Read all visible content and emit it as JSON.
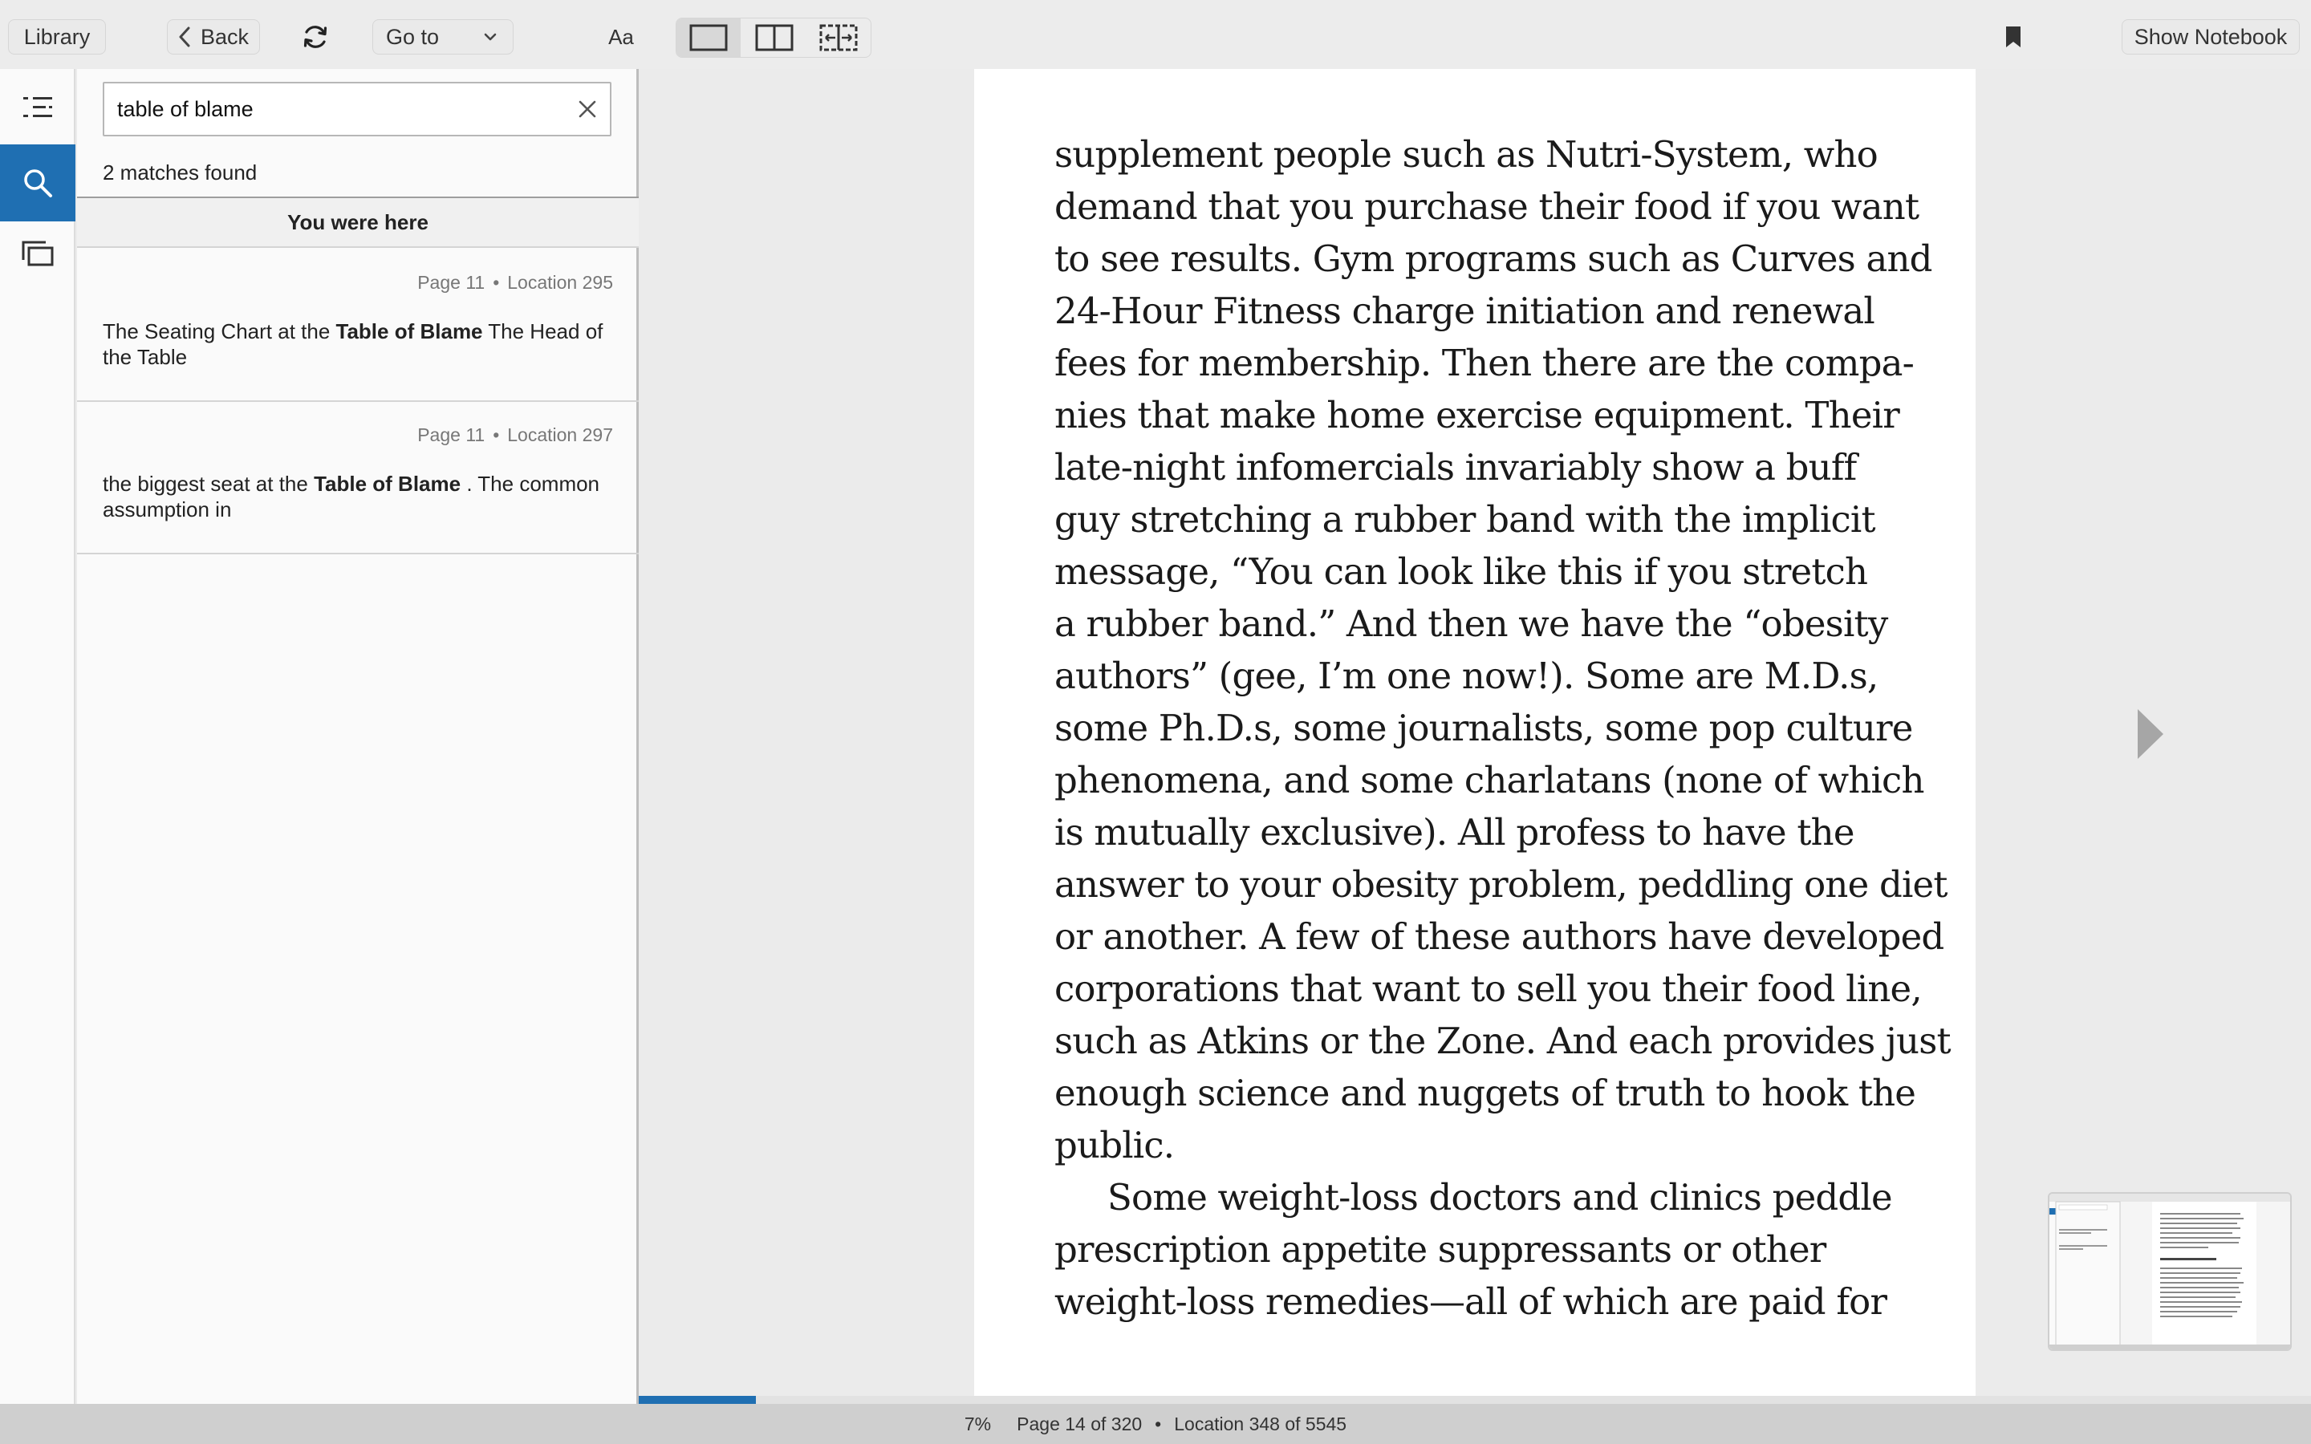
{
  "toolbar": {
    "library_label": "Library",
    "back_label": "Back",
    "goto_label": "Go to",
    "font_label": "Aa",
    "show_notebook_label": "Show Notebook"
  },
  "search": {
    "query": "table of blame",
    "matches_text": "2 matches found",
    "you_were_here": "You were here",
    "results": [
      {
        "page": "Page 11",
        "location": "Location 295",
        "before": "The Seating Chart at the ",
        "highlight": "Table of Blame",
        "after": " The Head of the Table"
      },
      {
        "page": "Page 11",
        "location": "Location 297",
        "before": "the biggest seat at the ",
        "highlight": "Table of Blame",
        "after": " . The common assumption in"
      }
    ]
  },
  "page_lines": [
    "supplement people such as Nutri-System, who",
    "demand that you purchase their food if you want",
    "to see results. Gym programs such as Curves and",
    "24-Hour Fitness charge initiation and renewal",
    "fees for membership. Then there are the compa-",
    "nies that make home exercise equipment. Their",
    "late-night infomercials invariably show a buff",
    "guy stretching a rubber band with the implicit",
    "message, “You can look like this if you stretch",
    "a rubber band.” And then we have the “obesity",
    "authors” (gee, I’m one now!). Some are M.D.s,",
    "some Ph.D.s, some journalists, some pop culture",
    "phenomena, and some charlatans (none of which",
    "is mutually exclusive). All profess to have the",
    "answer to your obesity problem, peddling one diet",
    "or another. A few of these authors have developed",
    "corporations that want to sell you their food line,",
    "such as Atkins or the Zone. And each provides just",
    "enough science and nuggets of truth to hook the",
    "public.",
    "Some weight-loss doctors and clinics peddle",
    "prescription appetite suppressants or other",
    "weight-loss remedies—all of which are paid for"
  ],
  "status": {
    "percent": "7%",
    "page": "Page 14 of 320",
    "location": "Location 348 of 5545",
    "progress_fraction": 0.07
  },
  "colors": {
    "accent": "#1f6fb2"
  },
  "icons": {
    "sync": "sync-icon",
    "bookmark": "bookmark-icon",
    "toc": "table-of-contents-icon",
    "search": "search-icon",
    "cards": "flashcards-icon",
    "next": "next-page-icon"
  }
}
